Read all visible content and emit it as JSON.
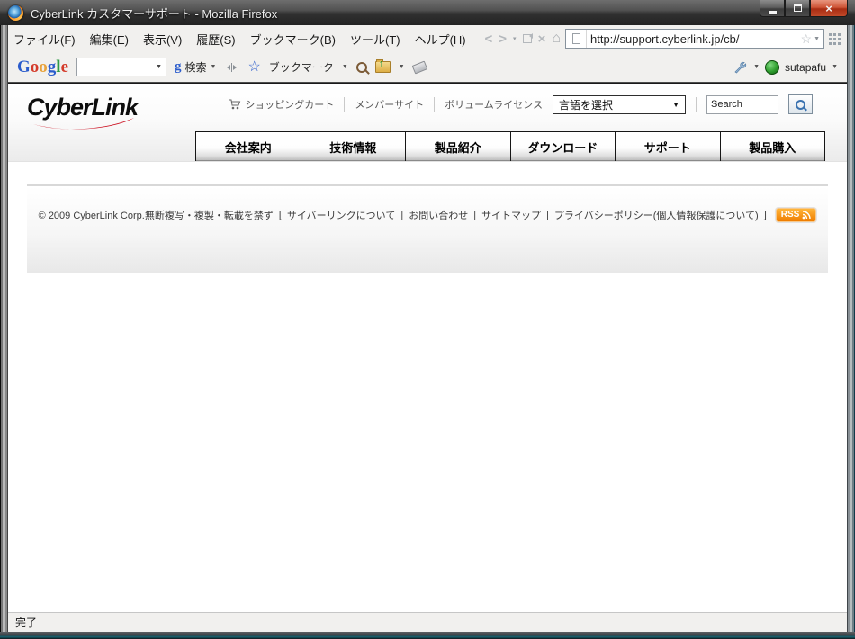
{
  "window": {
    "title": "CyberLink カスタマーサポート - Mozilla Firefox",
    "controls": {
      "close_glyph": "×"
    }
  },
  "menu_bar": {
    "items": [
      "ファイル(F)",
      "編集(E)",
      "表示(V)",
      "履歴(S)",
      "ブックマーク(B)",
      "ツール(T)",
      "ヘルプ(H)"
    ]
  },
  "nav_toolbar": {
    "url": "http://support.cyberlink.jp/cb/"
  },
  "google_toolbar": {
    "logo_letters": [
      "G",
      "o",
      "o",
      "g",
      "l",
      "e"
    ],
    "search_value": "",
    "search_button_g": "g",
    "search_button_label": "検索",
    "bookmarks_label": "ブックマーク",
    "account_name": "sutapafu"
  },
  "page": {
    "header": {
      "logo_text": "CyberLink",
      "utility_links": [
        "ショッピングカート",
        "メンバーサイト",
        "ボリュームライセンス"
      ],
      "language_select_label": "言語を選択",
      "search_value": "Search"
    },
    "nav_tabs": [
      "会社案内",
      "技術情報",
      "製品紹介",
      "ダウンロード",
      "サポート",
      "製品購入"
    ],
    "footer": {
      "copyright": "© 2009 CyberLink Corp.無断複写・複製・転載を禁ず",
      "bracket_open": "[",
      "separator": "|",
      "bracket_close": "]",
      "links": [
        "サイバーリンクについて",
        "お問い合わせ",
        "サイトマップ",
        "プライバシーポリシー(個人情報保護について)"
      ],
      "rss_label": "RSS"
    }
  },
  "status_bar": {
    "text": "完了"
  },
  "icons": {
    "back": "<",
    "forward": ">",
    "caret": "▼",
    "stop": "×",
    "home": "⌂",
    "star": "☆"
  },
  "colors": {
    "logo_swoosh_red": "#cc1122",
    "rss_orange": "#ef7d00",
    "close_button_red": "#c24a2a",
    "google_blue": "#2b5ccc",
    "google_red": "#d43a2a",
    "google_yellow": "#e8a33d",
    "google_green": "#2f9a47",
    "account_dot_green": "#2f9e2f"
  }
}
